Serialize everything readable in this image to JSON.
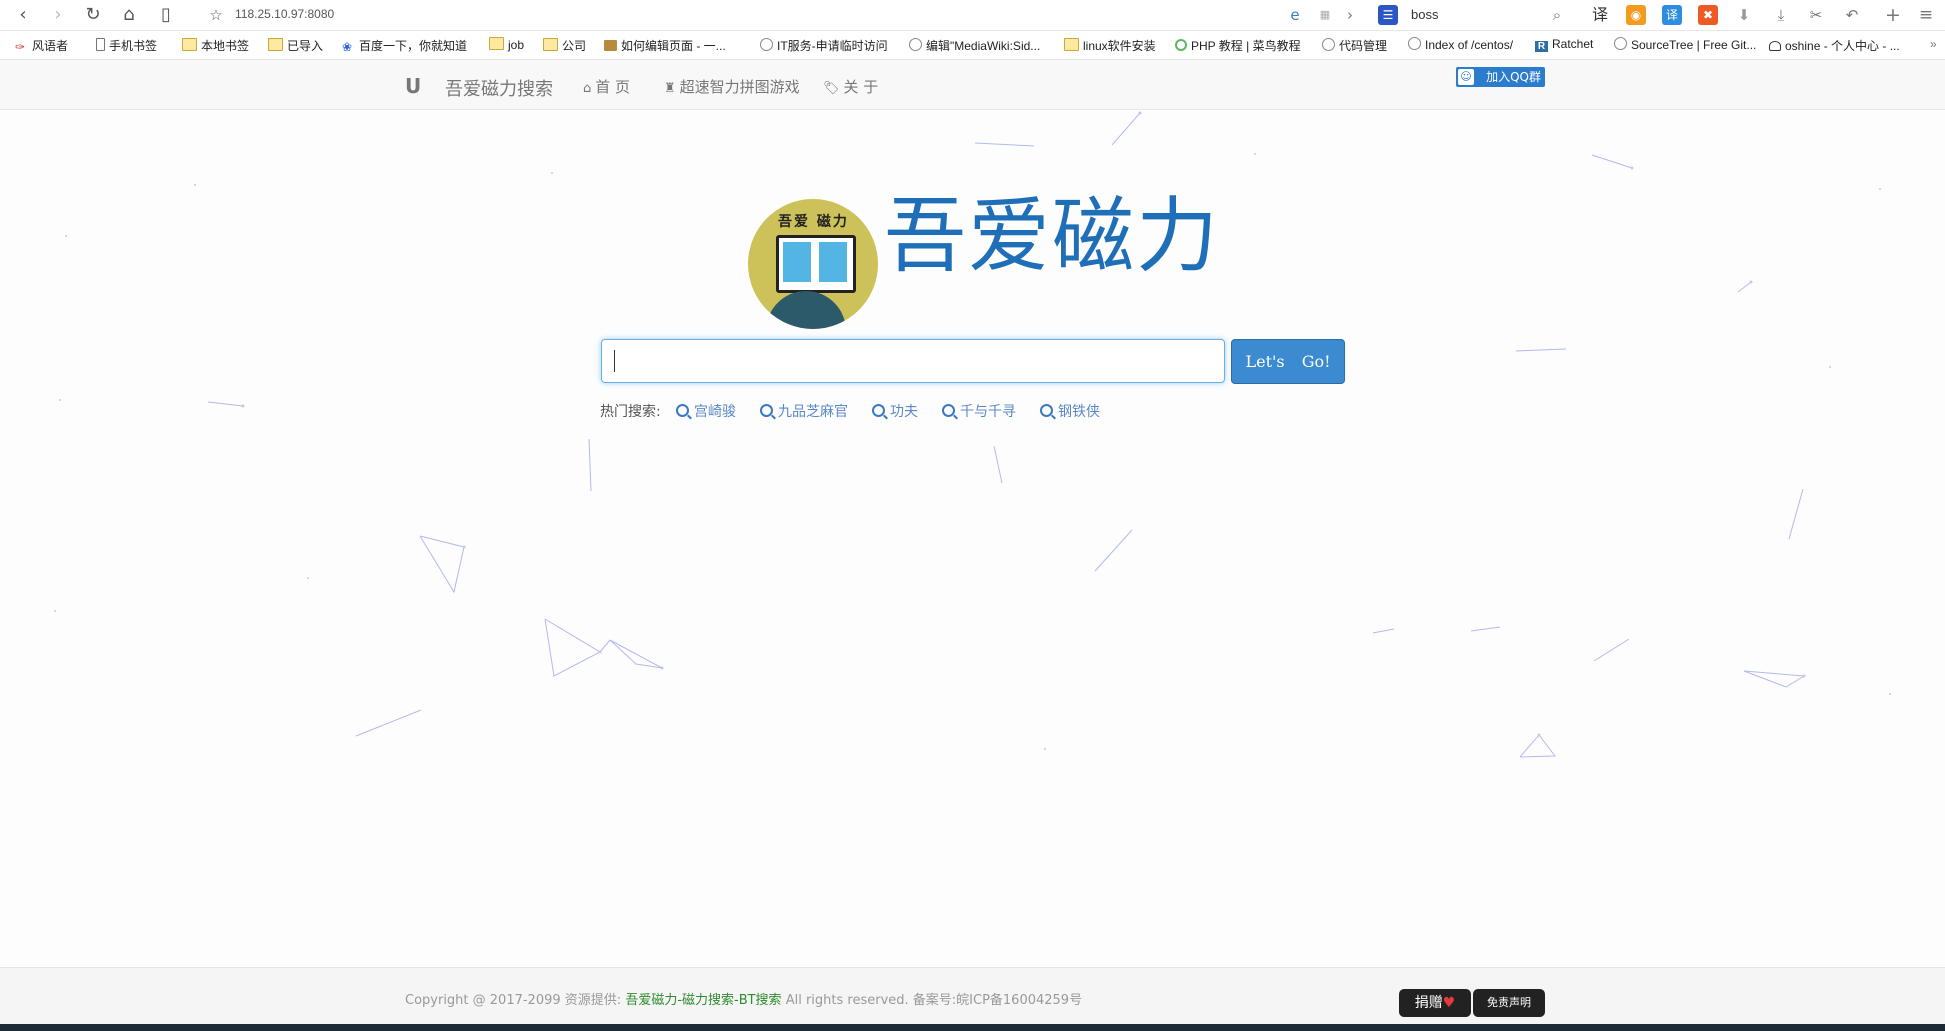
{
  "browser": {
    "url": "118.25.10.97:8080",
    "search_query": "boss",
    "ext_translate": "译",
    "ext_translate2": "译"
  },
  "bookmarks": [
    {
      "label": "风语者",
      "icon": "feather-icon"
    },
    {
      "label": "手机书签",
      "icon": "phone-icon"
    },
    {
      "label": "本地书签",
      "icon": "folder-icon"
    },
    {
      "label": "已导入",
      "icon": "folder-icon"
    },
    {
      "label": "百度一下，你就知道",
      "icon": "baidu-icon"
    },
    {
      "label": "job",
      "icon": "folder-icon"
    },
    {
      "label": "公司",
      "icon": "folder-icon"
    },
    {
      "label": "如何编辑页面 - 一...",
      "icon": "page-icon"
    },
    {
      "label": "IT服务-申请临时访问",
      "icon": "globe-icon"
    },
    {
      "label": "编辑\"MediaWiki:Sid...",
      "icon": "globe-icon"
    },
    {
      "label": "linux软件安装",
      "icon": "folder-icon"
    },
    {
      "label": "PHP 教程 | 菜鸟教程",
      "icon": "runoob-icon"
    },
    {
      "label": "代码管理",
      "icon": "globe-icon"
    },
    {
      "label": "Index of /centos/",
      "icon": "globe-icon"
    },
    {
      "label": "Ratchet",
      "icon": "ratchet-icon"
    },
    {
      "label": "SourceTree | Free Git...",
      "icon": "globe-icon"
    },
    {
      "label": "oshine - 个人中心 - ...",
      "icon": "oshine-icon"
    }
  ],
  "nav": {
    "brand": "吾爱磁力搜索",
    "links": [
      {
        "label": "首 页",
        "icon": "home-icon"
      },
      {
        "label": "超速智力拼图游戏",
        "icon": "rook-icon"
      },
      {
        "label": "关 于",
        "icon": "tags-icon"
      }
    ],
    "qq_button": "加入QQ群"
  },
  "logo": {
    "small_text": "吾爱 磁力",
    "title": "吾爱磁力"
  },
  "search": {
    "value": "",
    "button": "Let's Go!",
    "hot_label": "热门搜索:",
    "hot_items": [
      "宫崎骏",
      "九品芝麻官",
      "功夫",
      "千与千寻",
      "钢铁侠"
    ]
  },
  "footer": {
    "copyright_prefix": "Copyright @ 2017-2099 资源提供:",
    "site_link": "吾爱磁力-磁力搜索-BT搜索",
    "copyright_suffix": "All rights reserved. 备案号:皖ICP备16004259号",
    "donate": "捐赠",
    "disclaimer": "免责声明"
  },
  "colors": {
    "accent": "#3c8bd0",
    "logo_text": "#1f6fb8",
    "hot_link": "#5a89c7",
    "footer_link": "#2e8b2e"
  }
}
